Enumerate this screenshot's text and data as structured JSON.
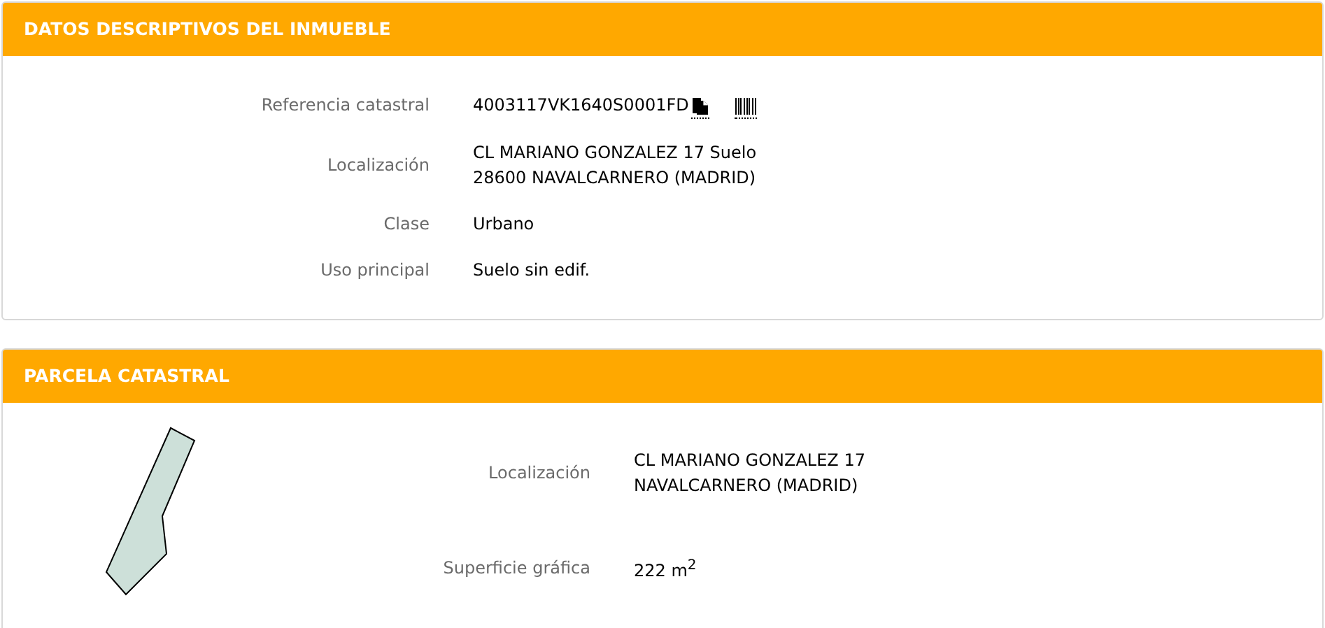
{
  "sections": [
    {
      "title": "DATOS DESCRIPTIVOS DEL INMUEBLE",
      "kind": "details",
      "rows": [
        {
          "kind": "reference",
          "label": "Referencia catastral",
          "lines": [
            "4003117VK1640S0001FD"
          ]
        },
        {
          "kind": "text",
          "label": "Localización",
          "lines": [
            "CL MARIANO GONZALEZ 17 Suelo",
            "28600 NAVALCARNERO (MADRID)"
          ]
        },
        {
          "kind": "text",
          "label": "Clase",
          "lines": [
            "Urbano"
          ]
        },
        {
          "kind": "text",
          "label": "Uso principal",
          "lines": [
            "Suelo sin edif."
          ]
        }
      ]
    },
    {
      "title": "PARCELA CATASTRAL",
      "kind": "parcel",
      "rows": [
        {
          "kind": "text",
          "label": "Localización",
          "lines": [
            "CL MARIANO GONZALEZ 17",
            "NAVALCARNERO (MADRID)"
          ]
        },
        {
          "kind": "text",
          "label": "Superficie gráfica",
          "lines": [
            "222 m$^{2}$"
          ]
        }
      ]
    }
  ]
}
